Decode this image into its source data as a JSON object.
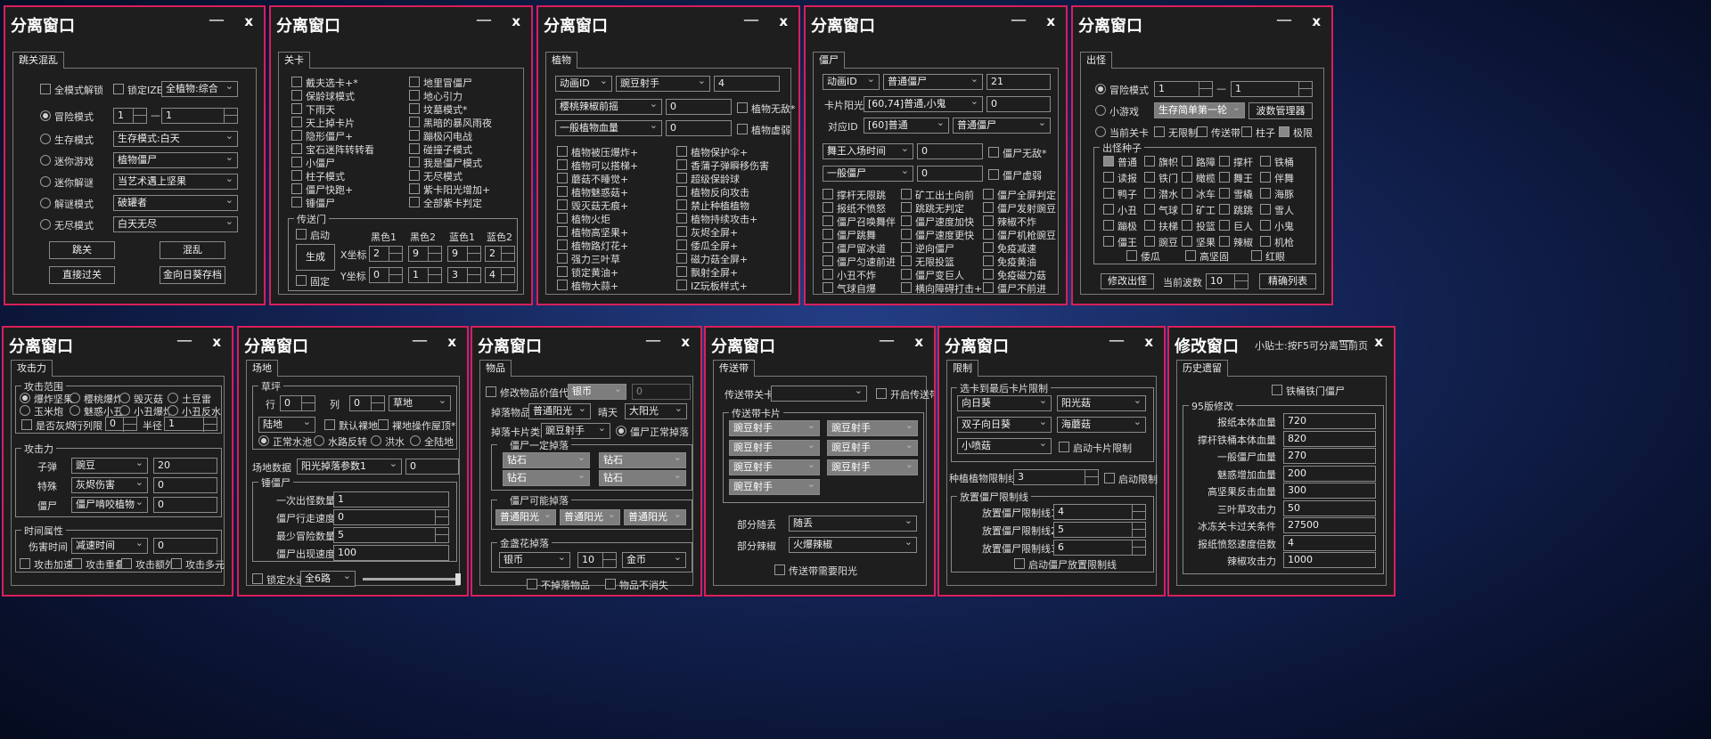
{
  "common": {
    "window_title": "分离窗口",
    "minimize": "—",
    "close": "x"
  },
  "w1": {
    "tab": "跳关混乱",
    "all_mode_unlock": "全模式解锁",
    "lock_ize": "锁定IZE",
    "ize_combo": "全植物:综合",
    "adventure": "冒险模式",
    "adv_a": "1",
    "dash": "—",
    "adv_b": "1",
    "survival": "生存模式",
    "survival_combo": "生存模式:白天",
    "mini": "迷你游戏",
    "mini_combo": "植物僵尸",
    "puzzle": "迷你解谜",
    "puzzle_combo": "当艺术遇上坚果",
    "solve": "解谜模式",
    "solve_combo": "破罐者",
    "endless": "无尽模式",
    "endless_combo": "白天无尽",
    "btn_jump": "跳关",
    "btn_chaos": "混乱",
    "btn_direct": "直接过关",
    "btn_gold": "金向日葵存档"
  },
  "w2": {
    "tab": "关卡",
    "left_opts": [
      "戴夫选卡+*",
      "保龄球模式",
      "下雨天",
      "天上掉卡片",
      "隐形僵尸+",
      "宝石迷阵转转看",
      "小僵尸",
      "柱子模式",
      "僵尸快跑+",
      "锤僵尸"
    ],
    "right_opts": [
      "地里冒僵尸",
      "地心引力",
      "坟墓模式*",
      "黑暗的暴风雨夜",
      "蹦极闪电战",
      "碰撞子模式",
      "我是僵尸模式",
      "无尽模式",
      "紫卡阳光增加+",
      "全部紫卡判定"
    ],
    "portal_group": "传送门",
    "start": "启动",
    "fixed": "固定",
    "generate": "生成",
    "cols": [
      "黑色1",
      "黑色2",
      "蓝色1",
      "蓝色2"
    ],
    "x_label": "X坐标",
    "y_label": "Y坐标",
    "x_vals": [
      "2",
      "9",
      "9",
      "2"
    ],
    "y_vals": [
      "0",
      "1",
      "3",
      "4"
    ]
  },
  "w3": {
    "tab": "植物",
    "anim_combo": "动画ID",
    "plant_combo": "豌豆射手",
    "plant_val": "4",
    "cherry_combo": "樱桃辣椒前摇",
    "cherry_val": "0",
    "invincible": "植物无敌*",
    "hp_combo": "一般植物血量",
    "hp_val": "0",
    "weak": "植物虚弱",
    "left_opts": [
      "植物被压爆炸+",
      "植物可以搭梯+",
      "蘑菇不睡觉+",
      "植物魅惑菇+",
      "毁灭菇无痕+",
      "植物火炬",
      "植物高坚果+",
      "植物路灯花+",
      "强力三叶草",
      "锁定黄油+",
      "植物大蒜+"
    ],
    "right_opts": [
      "植物保护伞+",
      "香蒲子弹瞬移伤害",
      "超级保龄球",
      "植物反向攻击",
      "禁止种植植物",
      "植物持续攻击+",
      "灰烬全屏+",
      "倭瓜全屏+",
      "磁力菇全屏+",
      "飘射全屏+",
      "IZ玩板样式+"
    ]
  },
  "w4": {
    "tab": "僵尸",
    "anim_combo": "动画ID",
    "zombie_combo": "普通僵尸",
    "zombie_val": "21",
    "card_label": "卡片阳光",
    "card_combo": "[60,74]普通,小鬼",
    "card_val": "0",
    "id_label": "对应ID",
    "id_combo": "[60]普通",
    "id_combo2": "普通僵尸",
    "dance_combo": "舞王入场时间",
    "dance_val": "0",
    "invincible": "僵尸无敌*",
    "hp_combo": "一般僵尸",
    "hp_val": "0",
    "weak": "僵尸虚弱",
    "col1": [
      "撑杆无限跳",
      "报纸不愤怒",
      "僵尸召唤舞伴",
      "僵尸跳舞",
      "僵尸留冰道",
      "僵尸匀速前进",
      "小丑不炸",
      "气球自爆"
    ],
    "col2": [
      "矿工出土向前",
      "跳跳无判定",
      "僵尸速度加快",
      "僵尸速度更快",
      "逆向僵尸",
      "无限投篮",
      "僵尸变巨人",
      "横向障碍打击+"
    ],
    "col3": [
      "僵尸全屏判定",
      "僵尸发射豌豆",
      "辣椒不炸",
      "僵尸机枪豌豆",
      "免疫减速",
      "免疫黄油",
      "免疫磁力菇",
      "僵尸不前进"
    ]
  },
  "w5": {
    "tab": "出怪",
    "adventure": "冒险模式",
    "adv_a": "1",
    "dash": "—",
    "adv_b": "1",
    "mini": "小游戏",
    "mini_combo": "生存简单第一轮",
    "wave_mgr": "波数管理器",
    "current": "当前关卡",
    "no_limit": "无限制",
    "conveyor": "传送带",
    "pillar": "柱子",
    "extreme": "极限",
    "seeds_group": "出怪种子",
    "seeds": [
      [
        "普通",
        "旗帜",
        "路障",
        "撑杆",
        "铁桶"
      ],
      [
        "读报",
        "铁门",
        "橄榄",
        "舞王",
        "伴舞"
      ],
      [
        "鸭子",
        "潜水",
        "冰车",
        "雪橇",
        "海豚"
      ],
      [
        "小丑",
        "气球",
        "矿工",
        "跳跳",
        "雪人"
      ],
      [
        "蹦极",
        "扶梯",
        "投篮",
        "巨人",
        "小鬼"
      ],
      [
        "僵王",
        "豌豆",
        "坚果",
        "辣椒",
        "机枪"
      ]
    ],
    "seeds_last": [
      "倭瓜",
      "高坚固",
      "红眼"
    ],
    "modify": "修改出怪",
    "current_wave": "当前波数",
    "wave_val": "10",
    "precise": "精确列表"
  },
  "w6": {
    "tab": "攻击力",
    "range_group": "攻击范围",
    "range_opts": [
      "爆炸坚果",
      "樱桃爆炸",
      "毁灭菇",
      "土豆雷",
      "玉米炮",
      "魅惑小丑",
      "小丑爆炸",
      "小丑反水"
    ],
    "gray": "是否灰烬",
    "row_label": "行列限",
    "row_val": "0",
    "radius_label": "半径",
    "radius_val": "1",
    "attack_group": "攻击力",
    "bullet_label": "子弹",
    "bullet_combo": "豌豆",
    "bullet_val": "20",
    "special_label": "特殊",
    "special_combo": "灰烬伤害",
    "special_val": "0",
    "zombie_label": "僵尸",
    "zombie_combo": "僵尸啃咬植物",
    "zombie_val": "0",
    "time_group": "时间属性",
    "dmg_time_label": "伤害时间",
    "dmg_time_combo": "减速时间",
    "dmg_time_val": "0",
    "opts": [
      "攻击加速",
      "攻击重叠",
      "攻击额外",
      "攻击多元"
    ]
  },
  "w7": {
    "tab": "场地",
    "lawn_group": "草坪",
    "row_label": "行",
    "row_val": "0",
    "col_label": "列",
    "col_val": "0",
    "lawn_combo": "草地",
    "land_combo": "陆地",
    "default_land": "默认裸地",
    "bare_op": "裸地操作屋顶*",
    "water_opts": [
      "正常水池",
      "水路反转",
      "洪水",
      "全陆地"
    ],
    "field_label": "场地数据",
    "field_combo": "阳光掉落参数1",
    "field_val": "0",
    "hammer_group": "锤僵尸",
    "hammer_rows": [
      {
        "label": "一次出怪数量",
        "val": "1"
      },
      {
        "label": "僵尸行走速度",
        "val": "0"
      },
      {
        "label": "最少冒险数量",
        "val": "5"
      },
      {
        "label": "僵尸出现速度",
        "val": "100"
      }
    ],
    "lock_water": "锁定水道",
    "lock_combo": "全6路"
  },
  "w8": {
    "tab": "物品",
    "modify_price": "修改物品价值代码",
    "price_combo": "银币",
    "price_val": "0",
    "drop_label": "掉落物品",
    "drop_combo": "普通阳光",
    "weather_label": "晴天",
    "weather_combo": "大阳光",
    "card_type_label": "掉落卡片类型",
    "card_type_combo": "豌豆射手",
    "zombie_drop": "僵尸正常掉落",
    "fixed_group": "僵尸一定掉落",
    "fixed_combos": [
      "钻石",
      "钻石",
      "钻石",
      "钻石"
    ],
    "possible_group": "僵尸可能掉落",
    "possible_combos": [
      "普通阳光",
      "普通阳光",
      "普通阳光"
    ],
    "gold_group": "金盏花掉落",
    "gold_combo": "银币",
    "gold_val": "10",
    "gold_combo2": "金币",
    "no_drop": "不掉落物品",
    "no_vanish": "物品不消失"
  },
  "w9": {
    "tab": "传送带",
    "level_label": "传送带关卡",
    "open": "开启传送带",
    "card_group": "传送带卡片",
    "cards": [
      "豌豆射手",
      "豌豆射手",
      "豌豆射手",
      "豌豆射手",
      "豌豆射手",
      "豌豆射手",
      "豌豆射手"
    ],
    "part1_label": "部分随丢",
    "part1_combo": "随丢",
    "part2_label": "部分辣椒",
    "part2_combo": "火爆辣椒",
    "need_sun": "传送带需要阳光"
  },
  "w10": {
    "tab": "限制",
    "card_group": "选卡到最后卡片限制",
    "combos": [
      "向日葵",
      "阳光菇",
      "双子向日葵",
      "海蘑菇",
      "小喷菇"
    ],
    "card_limit": "启动卡片限制",
    "plant_limit_label": "种植植物限制线",
    "plant_limit_val": "3",
    "plant_limit_on": "启动限制",
    "zombie_group": "放置僵尸限制线",
    "zombie_rows": [
      {
        "label": "放置僵尸限制线1",
        "val": "4"
      },
      {
        "label": "放置僵尸限制线2",
        "val": "5"
      },
      {
        "label": "放置僵尸限制线3",
        "val": "6"
      }
    ],
    "zombie_limit_on": "启动僵尸放置限制线"
  },
  "w11": {
    "title": "修改窗口",
    "tip": "小贴士:按F5可分离当前页",
    "tab": "历史遗留",
    "iron_door": "铁桶铁门僵尸",
    "group": "95版修改",
    "rows": [
      {
        "label": "报纸本体血量",
        "val": "720"
      },
      {
        "label": "撑杆铁桶本体血量",
        "val": "820"
      },
      {
        "label": "一般僵尸血量",
        "val": "270"
      },
      {
        "label": "魅惑增加血量",
        "val": "200"
      },
      {
        "label": "高坚果反击血量",
        "val": "300"
      },
      {
        "label": "三叶草攻击力",
        "val": "50"
      },
      {
        "label": "冰冻关卡过关条件",
        "val": "27500"
      },
      {
        "label": "报纸愤怒速度倍数",
        "val": "4"
      },
      {
        "label": "辣椒攻击力",
        "val": "1000"
      }
    ]
  }
}
